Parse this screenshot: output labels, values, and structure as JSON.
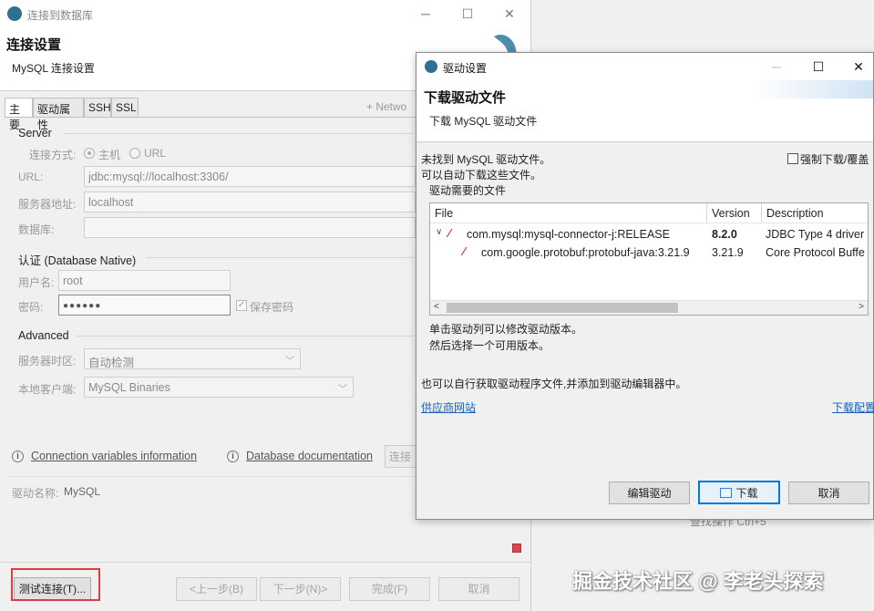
{
  "bg_dialog": {
    "title": "连接到数据库",
    "header_title": "连接设置",
    "header_subtitle": "MySQL 连接设置",
    "tabs": [
      {
        "label": "主要"
      },
      {
        "label": "驱动属性"
      },
      {
        "label": "SSH"
      },
      {
        "label": "SSL"
      }
    ],
    "network_label": "+ Netwo",
    "server": {
      "section_label": "Server",
      "connect_mode_label": "连接方式:",
      "option_host": "主机",
      "option_url": "URL",
      "url_label": "URL:",
      "url_value": "jdbc:mysql://localhost:3306/",
      "host_label": "服务器地址:",
      "host_value": "localhost",
      "db_label": "数据库:",
      "db_value": ""
    },
    "auth": {
      "section_label": "认证 (Database Native)",
      "user_label": "用户名:",
      "user_value": "root",
      "password_label": "密码:",
      "password_value": "●●●●●●",
      "save_password_label": "保存密码",
      "save_password_checked": true
    },
    "advanced": {
      "section_label": "Advanced",
      "timezone_label": "服务器时区:",
      "timezone_value": "自动检测",
      "client_label": "本地客户端:",
      "client_value": "MySQL Binaries"
    },
    "links": {
      "conn_vars": "Connection variables information",
      "db_docs": "Database documentation",
      "connect_details": "连接详"
    },
    "driver_name_label": "驱动名称:",
    "driver_name_value": "MySQL",
    "buttons": {
      "test": "测试连接(T)...",
      "prev": "<上一步(B)",
      "next": "下一步(N)>",
      "finish": "完成(F)",
      "cancel": "取消"
    }
  },
  "backdrop": {
    "hint": "查找操作  Ctrl+5",
    "watermark": "掘金技术社区 @ 李老头探索"
  },
  "driver_dialog": {
    "title": "驱动设置",
    "header_title": "下载驱动文件",
    "header_subtitle": "下载 MySQL 驱动文件",
    "msg_not_found": "未找到 MySQL 驱动文件。",
    "msg_auto": "可以自动下载这些文件。",
    "force_download_label": "强制下载/覆盖",
    "force_download_checked": false,
    "files_label": "驱动需要的文件",
    "table": {
      "headers": [
        "File",
        "Version",
        "Description"
      ],
      "rows": [
        {
          "file": "com.mysql:mysql-connector-j:RELEASE",
          "version": "8.2.0",
          "description": "JDBC Type 4 driver",
          "expanded": true
        },
        {
          "file": "com.google.protobuf:protobuf-java:3.21.9",
          "version": "3.21.9",
          "description": "Core Protocol Buffe"
        }
      ]
    },
    "hint1": "单击驱动列可以修改驱动版本。",
    "hint2": "然后选择一个可用版本。",
    "manual_msg": "也可以自行获取驱动程序文件,并添加到驱动编辑器中。",
    "vendor_link": "供应商网站",
    "download_config_link": "下载配置",
    "buttons": {
      "edit": "编辑驱动",
      "download": "下载",
      "cancel": "取消"
    }
  },
  "colors": {
    "accent_blue": "#0078d7",
    "link_blue": "#1a5fb4",
    "highlight_red": "#e23b3b"
  }
}
